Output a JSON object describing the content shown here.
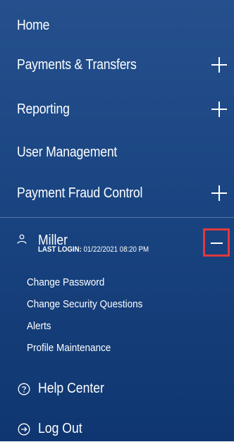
{
  "nav": {
    "home": "Home",
    "payments": "Payments & Transfers",
    "reporting": "Reporting",
    "user_management": "User Management",
    "fraud_control": "Payment Fraud Control"
  },
  "user": {
    "name": "Miller",
    "last_login_label": "LAST LOGIN:",
    "last_login_value": "01/22/2021 08:20 PM"
  },
  "submenu": {
    "change_password": "Change Password",
    "security_questions": "Change Security Questions",
    "alerts": "Alerts",
    "profile": "Profile Maintenance"
  },
  "bottom": {
    "help": "Help Center",
    "logout": "Log Out"
  },
  "colors": {
    "background": "#1b4683",
    "highlight": "#e0393e",
    "text": "#ffffff"
  },
  "icons": {
    "expand": "plus-icon",
    "collapse": "minus-icon",
    "user": "user-icon",
    "help": "question-circle-icon",
    "logout": "arrow-right-circle-icon"
  }
}
